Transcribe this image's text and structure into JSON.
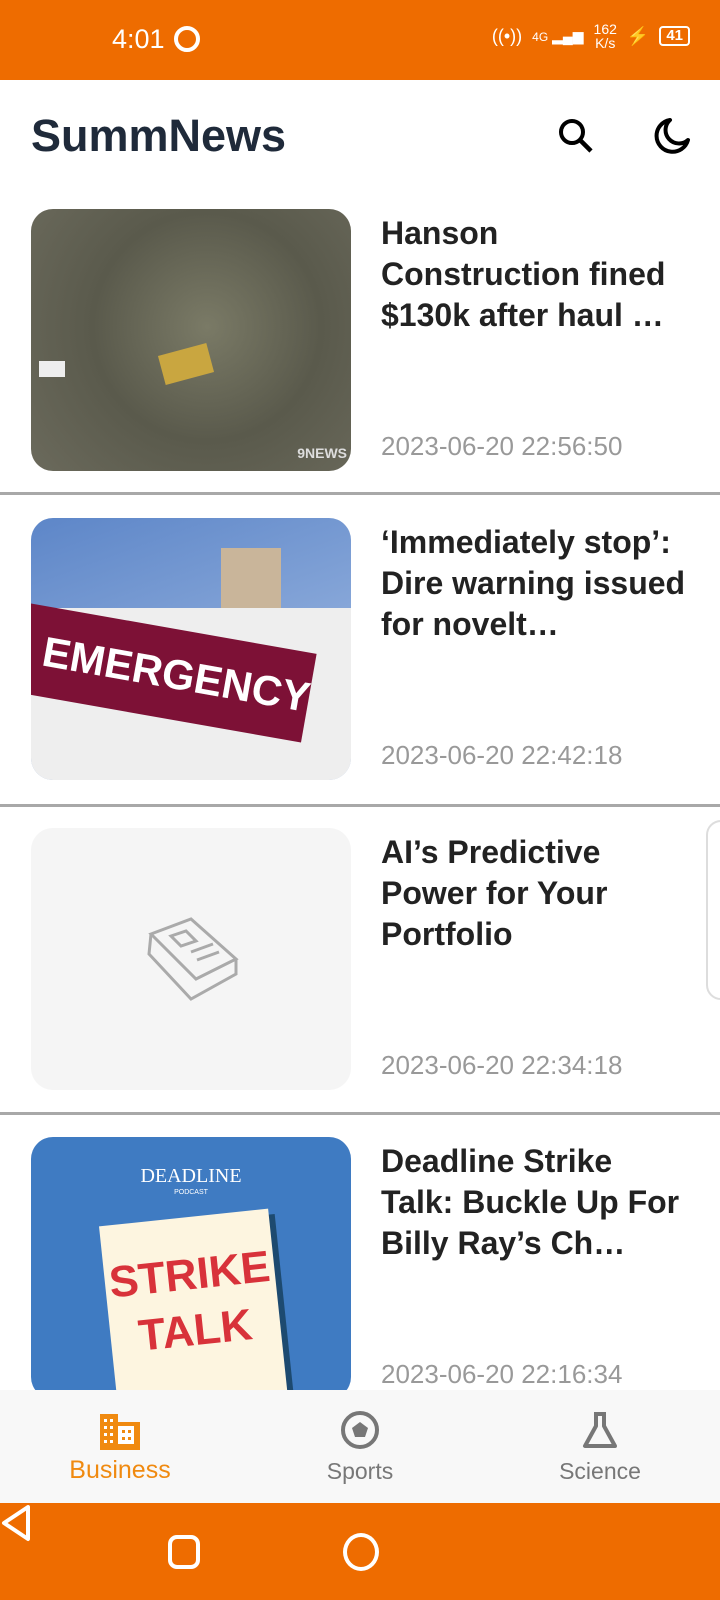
{
  "status_bar": {
    "time": "4:01",
    "network": "4G",
    "speed_value": "162",
    "speed_unit": "K/s",
    "battery": "41"
  },
  "header": {
    "title": "SummNews",
    "search_icon": "search-icon",
    "theme_icon": "moon-icon"
  },
  "articles": [
    {
      "title": "Hanson Construction fined $130k after haul …",
      "date": "2023-06-20 22:56:50",
      "image_text": "9NEWS"
    },
    {
      "title": "‘Immediately stop’: Dire warning issued for novelt…",
      "date": "2023-06-20 22:42:18",
      "image_text": "EMERGENCY"
    },
    {
      "title": "AI’s Predictive Power for Your Portfolio",
      "date": "2023-06-20 22:34:18"
    },
    {
      "title": "Deadline Strike Talk: Buckle Up For Billy Ray’s Ch…",
      "date": "2023-06-20 22:16:34",
      "image_text": "DEADLINE",
      "image_sub": "PODCAST",
      "image_sign1": "STRIKE",
      "image_sign2": "TALK"
    }
  ],
  "bottom_nav": [
    {
      "label": "Business",
      "active": true
    },
    {
      "label": "Sports"
    },
    {
      "label": "Science"
    }
  ],
  "colors": {
    "accent": "#ee6c00",
    "active_tab": "#f08a10"
  }
}
